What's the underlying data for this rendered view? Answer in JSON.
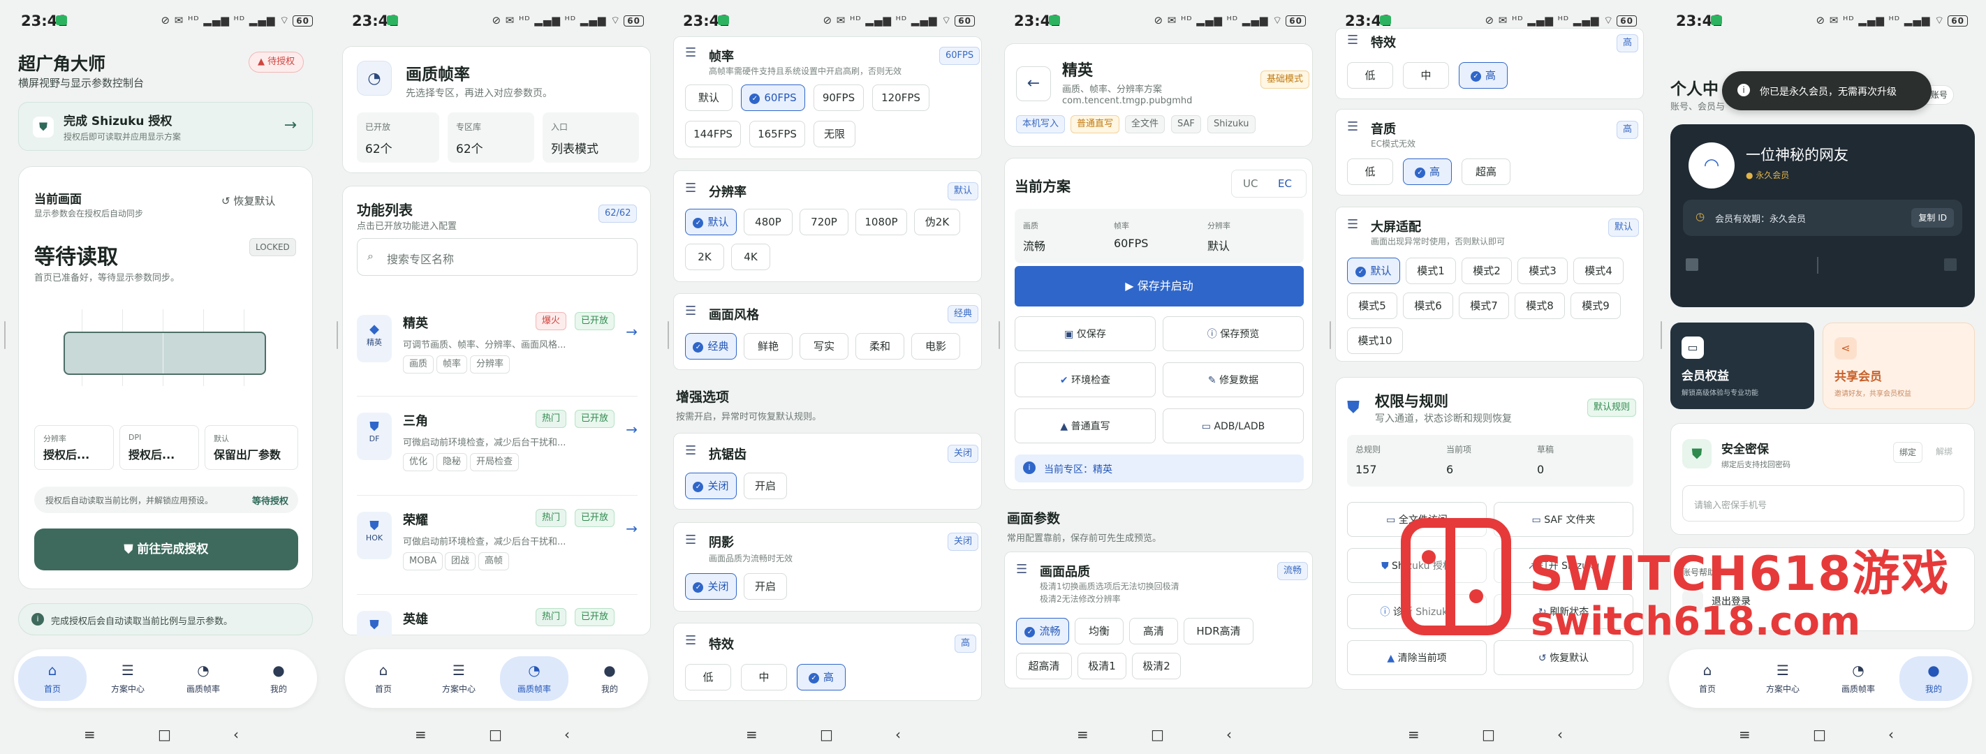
{
  "status": {
    "p1": "23:41",
    "p2": "23:41",
    "p3": "23:42",
    "p4": "23:42",
    "p5": "23:42",
    "p6": "23:42",
    "icons": "⊘ ✉ ᴴᴰ ▂▄▆ ᴴᴰ ▂▄▆ ⌔",
    "battery": "60"
  },
  "nav": {
    "home": "首页",
    "plans": "方案中心",
    "quality": "画质帧率",
    "mine": "我的"
  },
  "p1": {
    "title": "超广角大师",
    "subtitle": "横屏视野与显示参数控制台",
    "auth_badge": "待授权",
    "shizuku_title": "完成 Shizuku 授权",
    "shizuku_sub": "授权后即可读取并应用显示方案",
    "current_label": "当前画面",
    "current_sub": "显示参数会在授权后自动同步",
    "restore": "恢复默认",
    "waiting": "等待读取",
    "waiting_sub": "首页已准备好，等待显示参数同步。",
    "locked": "LOCKED",
    "res_l": "分辨率",
    "res_v": "授权后...",
    "dpi_l": "DPI",
    "dpi_v": "授权后...",
    "def_l": "默认",
    "def_v": "保留出厂参数",
    "hint": "授权后自动读取当前比例，并解锁应用预设。",
    "hint_tag": "等待授权",
    "go_btn": "前往完成授权",
    "foot": "完成授权后会自动读取当前比例与显示参数。"
  },
  "p2": {
    "title": "画质帧率",
    "subtitle": "先选择专区，再进入对应参数页。",
    "s1_l": "已开放",
    "s1_v": "62个",
    "s2_l": "专区库",
    "s2_v": "62个",
    "s3_l": "入口",
    "s3_v": "列表模式",
    "list_title": "功能列表",
    "list_sub": "点击已开放功能进入配置",
    "count": "62/62",
    "search": "搜索专区名称",
    "items": [
      {
        "icon": "精英",
        "name": "精英",
        "t1": "爆火",
        "t2": "已开放",
        "desc": "可调节画质、帧率、分辨率、画面风格...",
        "k1": "画质",
        "k2": "帧率",
        "k3": "分辨率"
      },
      {
        "icon": "DF",
        "name": "三角",
        "t1": "热门",
        "t2": "已开放",
        "desc": "可微启动前环境检查，减少后台干扰和...",
        "k1": "优化",
        "k2": "隐秘",
        "k3": "开局检查"
      },
      {
        "icon": "HOK",
        "name": "荣耀",
        "t1": "热门",
        "t2": "已开放",
        "desc": "可做启动前环境检查，减少后台干扰和...",
        "k1": "MOBA",
        "k2": "团战",
        "k3": "高帧"
      },
      {
        "icon": "",
        "name": "英雄",
        "t1": "热门",
        "t2": "已开放",
        "desc": "",
        "k1": "",
        "k2": "",
        "k3": ""
      }
    ]
  },
  "p3": {
    "fps_title": "帧率",
    "fps_sub": "高帧率需硬件支持且系统设置中开启高刷，否则无效",
    "fps_tag": "60FPS",
    "fps_opts": [
      "默认",
      "60FPS",
      "90FPS",
      "120FPS",
      "144FPS",
      "165FPS",
      "无限"
    ],
    "res_title": "分辨率",
    "res_tag": "默认",
    "res_opts": [
      "默认",
      "480P",
      "720P",
      "1080P",
      "伪2K",
      "2K",
      "4K"
    ],
    "style_title": "画面风格",
    "style_tag": "经典",
    "style_opts": [
      "经典",
      "鲜艳",
      "写实",
      "柔和",
      "电影"
    ],
    "enh_title": "增强选项",
    "enh_sub": "按需开启，异常时可恢复默认规则。",
    "aa_title": "抗锯齿",
    "aa_tag": "关闭",
    "aa_opts": [
      "关闭",
      "开启"
    ],
    "sh_title": "阴影",
    "sh_sub": "画面品质为流畅时无效",
    "sh_tag": "关闭",
    "sh_opts": [
      "关闭",
      "开启"
    ],
    "fx_title": "特效",
    "fx_tag": "高",
    "fx_opts": [
      "低",
      "中",
      "高"
    ]
  },
  "p4": {
    "title": "精英",
    "subtitle": "画质、帧率、分辨率方案",
    "pkg": "com.tencent.tmgp.pubgmhd",
    "mode": "基础模式",
    "tags": [
      "本机写入",
      "普通直写",
      "全文件",
      "SAF",
      "Shizuku"
    ],
    "plan_title": "当前方案",
    "uc": "UC",
    "ec": "EC",
    "q_l": "画质",
    "q_v": "流畅",
    "f_l": "帧率",
    "f_v": "60FPS",
    "r_l": "分辨率",
    "r_v": "默认",
    "save_launch": "保存并启动",
    "save_only": "仅保存",
    "save_preview": "保存预览",
    "env": "环境检查",
    "repair": "修复数据",
    "direct": "普通直写",
    "adb": "ADB/LADB",
    "zone": "当前专区：精英",
    "params_title": "画面参数",
    "params_sub": "常用配置靠前，保存前可先生成预览。",
    "pq_title": "画面品质",
    "pq_sub": "极清1切换画质选项后无法切换回极清\n极清2无法修改分辨率",
    "pq_tag": "流畅",
    "pq_opts": [
      "流畅",
      "均衡",
      "高清",
      "HDR高清",
      "超高清",
      "极清1",
      "极清2"
    ]
  },
  "p5": {
    "fx_title": "特效",
    "fx_tag": "高",
    "fx_opts": [
      "低",
      "中",
      "高"
    ],
    "snd_title": "音质",
    "snd_sub": "EC模式无效",
    "snd_tag": "高",
    "snd_opts": [
      "低",
      "高",
      "超高"
    ],
    "big_title": "大屏适配",
    "big_sub": "画面出现异常时使用，否则默认即可",
    "big_tag": "默认",
    "big_opts": [
      "默认",
      "模式1",
      "模式2",
      "模式3",
      "模式4",
      "模式5",
      "模式6",
      "模式7",
      "模式8",
      "模式9",
      "模式10"
    ],
    "perm_title": "权限与规则",
    "perm_sub": "写入通道，状态诊断和规则恢复",
    "perm_tag": "默认规则",
    "c1_l": "总规则",
    "c1_v": "157",
    "c2_l": "当前项",
    "c2_v": "6",
    "c3_l": "草稿",
    "c3_v": "0",
    "b1": "全文件访问",
    "b2": "SAF 文件夹",
    "b3": "Shizuku 授权",
    "b4": "打开 Shizuku",
    "b5": "诊断 Shizuku",
    "b6": "刷新状态",
    "b7": "清除当前项",
    "b8": "恢复默认",
    "wm1": "SWITCH618游戏",
    "wm2": "switch618.com"
  },
  "p6": {
    "title": "个人中",
    "sub": "账号、会员与",
    "toast": "你已是永久会员，无需再次升级",
    "switch": "切换账号",
    "name": "一位神秘的网友",
    "vip": "永久会员",
    "expire": "会员有效期：永久会员",
    "copy_id": "复制 ID",
    "vip_card": "会员权益",
    "vip_card_sub": "解锁高级体验与专业功能",
    "share_card": "共享会员",
    "share_card_sub": "邀请好友，共享会员权益",
    "sec_title": "安全密保",
    "sec_sub": "绑定后支持找回密码",
    "bind": "绑定",
    "unbind": "解绑",
    "phone_ph": "请输入密保手机号",
    "acct": "账号帮助",
    "logout": "退出登录"
  }
}
